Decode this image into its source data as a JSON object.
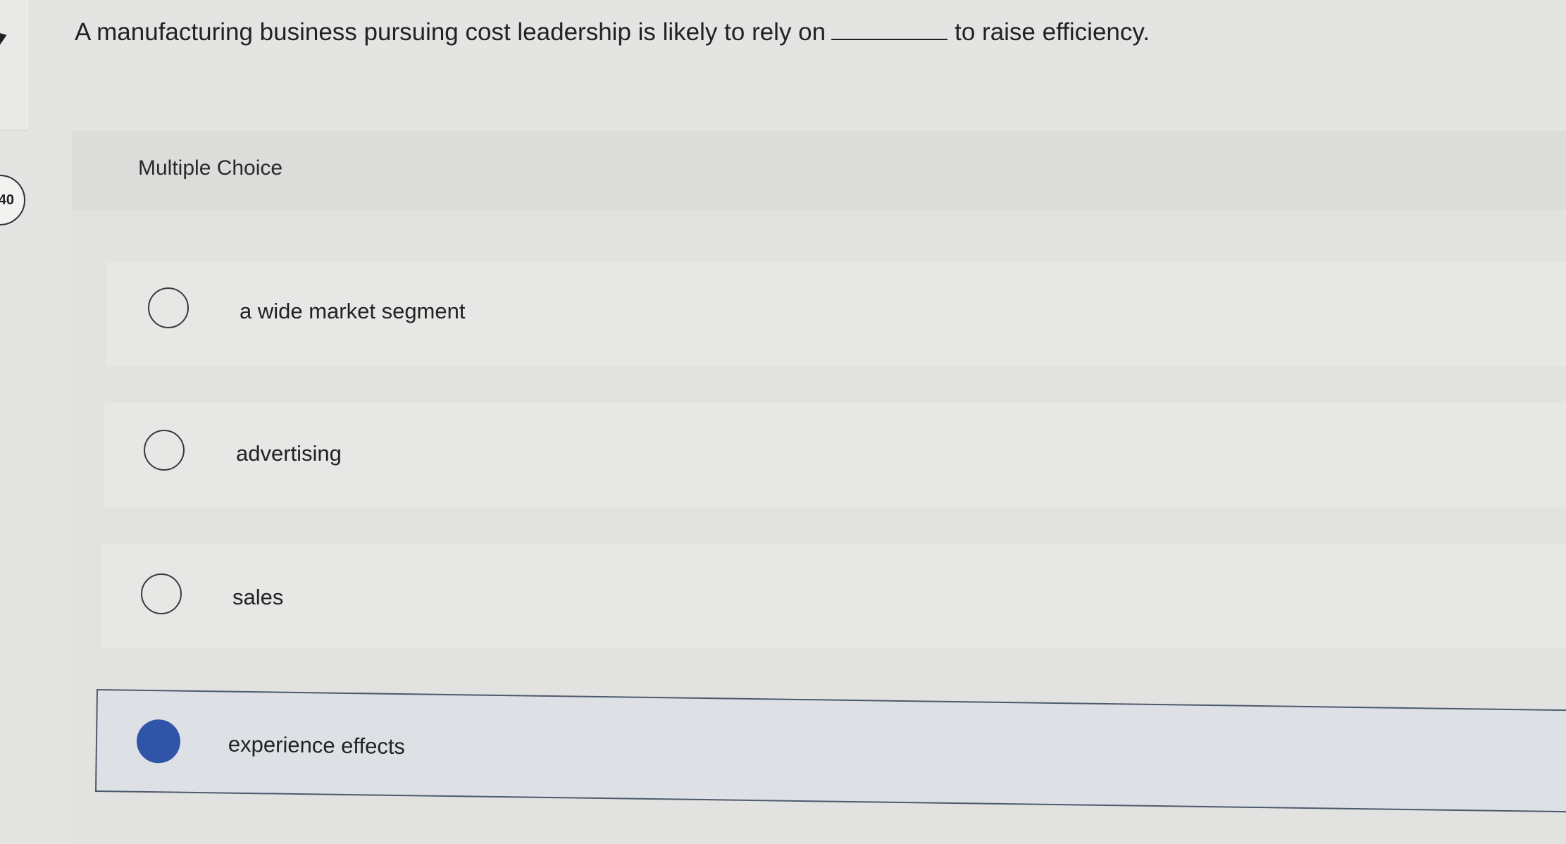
{
  "question": {
    "number": "40",
    "text_before": "A manufacturing business pursuing cost leadership is likely to rely on",
    "text_after": "to raise efficiency."
  },
  "multiple_choice": {
    "label": "Multiple Choice",
    "options": [
      {
        "label": "a wide market segment",
        "selected": false
      },
      {
        "label": "advertising",
        "selected": false
      },
      {
        "label": "sales",
        "selected": false
      },
      {
        "label": "experience effects",
        "selected": true
      }
    ]
  },
  "colors": {
    "selected_radio": "#3055a8",
    "selected_border": "#4d5a6c"
  }
}
